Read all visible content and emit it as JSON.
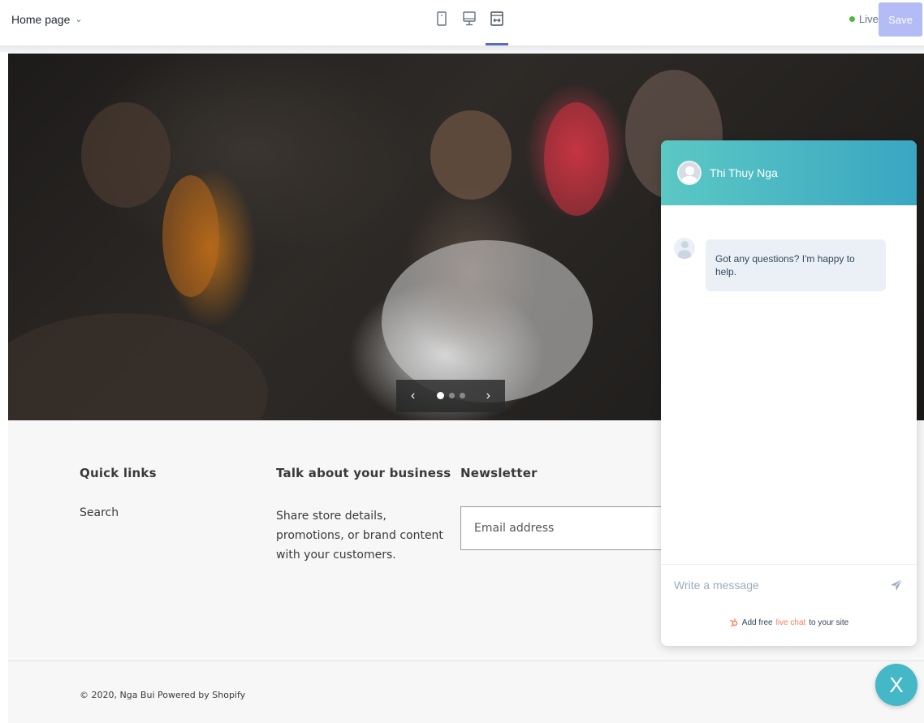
{
  "topbar": {
    "page_selector": "Home page",
    "live_label": "Live",
    "save_label": "Save",
    "live_color": "#50b83c",
    "accent_color": "#5c6ac4",
    "devices": [
      "mobile-icon",
      "desktop-icon",
      "fullscreen-icon"
    ]
  },
  "hero": {
    "slides_total": 3,
    "active_slide": 1
  },
  "footer": {
    "quick_links_title": "Quick links",
    "quick_links": [
      "Search"
    ],
    "business_title": "Talk about your business",
    "business_text": "Share store details, promotions, or brand content with your customers.",
    "newsletter_title": "Newsletter",
    "email_placeholder": "Email address",
    "copyright": "© 2020, Nga Bui Powered by Shopify"
  },
  "chat": {
    "agent_name": "Thi Thuy Nga",
    "message": "Got any questions? I'm happy to help.",
    "composer_placeholder": "Write a message",
    "branding_prefix": "Add free",
    "branding_link": "live chat",
    "branding_suffix": "to your site",
    "header_color_start": "#5bc8c4",
    "header_color_end": "#3aa6c2",
    "close_label": "X"
  }
}
